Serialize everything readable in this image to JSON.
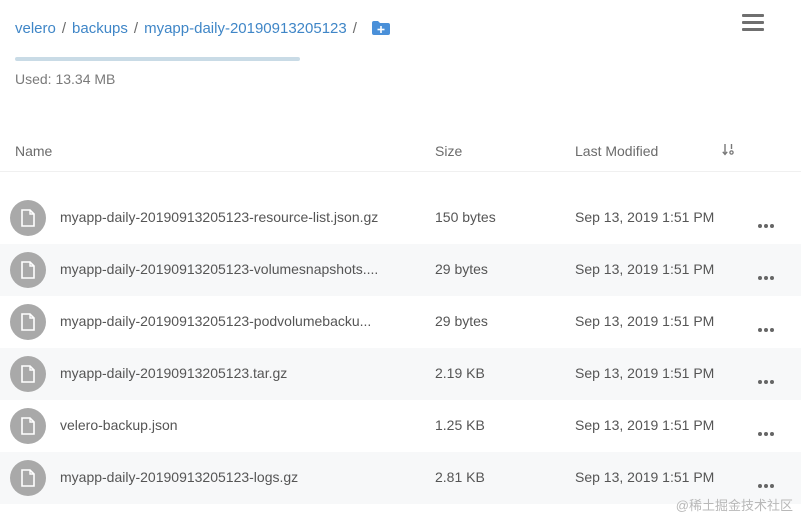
{
  "breadcrumb": {
    "items": [
      "velero",
      "backups",
      "myapp-daily-20190913205123"
    ],
    "separator": "/"
  },
  "usage": {
    "used_text": "Used: 13.34 MB",
    "bar_color": "#c9dbe6"
  },
  "table": {
    "headers": {
      "name": "Name",
      "size": "Size",
      "modified": "Last Modified"
    },
    "rows": [
      {
        "name": "myapp-daily-20190913205123-resource-list.json.gz",
        "size": "150 bytes",
        "modified": "Sep 13, 2019 1:51 PM"
      },
      {
        "name": "myapp-daily-20190913205123-volumesnapshots....",
        "size": "29 bytes",
        "modified": "Sep 13, 2019 1:51 PM"
      },
      {
        "name": "myapp-daily-20190913205123-podvolumebacku...",
        "size": "29 bytes",
        "modified": "Sep 13, 2019 1:51 PM"
      },
      {
        "name": "myapp-daily-20190913205123.tar.gz",
        "size": "2.19 KB",
        "modified": "Sep 13, 2019 1:51 PM"
      },
      {
        "name": "velero-backup.json",
        "size": "1.25 KB",
        "modified": "Sep 13, 2019 1:51 PM"
      },
      {
        "name": "myapp-daily-20190913205123-logs.gz",
        "size": "2.81 KB",
        "modified": "Sep 13, 2019 1:51 PM"
      }
    ]
  },
  "icons": {
    "folder_add": "folder-plus-icon",
    "menu": "hamburger-menu-icon",
    "sort": "sort-icon",
    "file": "file-icon",
    "more": "more-horizontal-icon"
  },
  "colors": {
    "link": "#3f86c7",
    "icon_bg": "#a9a9a9",
    "row_alt": "#f7f8f9"
  },
  "watermark": "@稀土掘金技术社区"
}
